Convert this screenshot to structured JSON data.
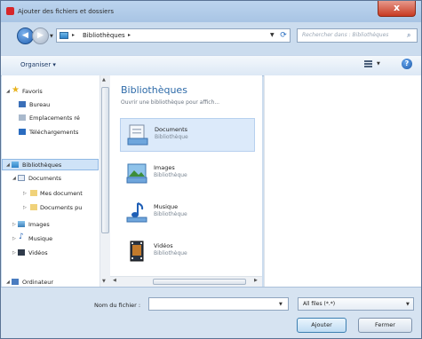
{
  "window": {
    "title": "Ajouter des fichiers et dossiers",
    "close_symbol": "x"
  },
  "address": {
    "back_symbol": "◀",
    "forward_symbol": "▶",
    "separator": "▸",
    "current_location": "Bibliothèques",
    "search_placeholder": "Rechercher dans : Bibliothèques"
  },
  "toolbar": {
    "organize_label": "Organiser ▾"
  },
  "nav": {
    "favorites": {
      "label": "Favoris",
      "items": [
        "Bureau",
        "Emplacements ré",
        "Téléchargements"
      ]
    },
    "libraries": {
      "label": "Bibliothèques"
    },
    "documents": {
      "label": "Documents",
      "children": [
        "Mes document",
        "Documents pu"
      ]
    },
    "images": "Images",
    "music": "Musique",
    "videos": "Vidéos",
    "computer": "Ordinateur"
  },
  "content": {
    "title": "Bibliothèques",
    "subtitle": "Ouvrir une bibliothèque pour affich...",
    "libraries": [
      {
        "name": "Documents",
        "type": "Bibliothèque",
        "icon": "documents-icon",
        "selected": true
      },
      {
        "name": "Images",
        "type": "Bibliothèque",
        "icon": "images-icon",
        "selected": false
      },
      {
        "name": "Musique",
        "type": "Bibliothèque",
        "icon": "music-icon",
        "selected": false
      },
      {
        "name": "Vidéos",
        "type": "Bibliothèque",
        "icon": "videos-icon",
        "selected": false
      }
    ]
  },
  "bottom": {
    "filename_label": "Nom du fichier :",
    "filename_value": "",
    "filter_value": "All files (*.*)",
    "open_button": "Ajouter",
    "cancel_button": "Fermer"
  },
  "colors": {
    "accent_blue": "#2d6aa8",
    "selection": "#dceafa",
    "close_red": "#c73a22",
    "frame": "#cbdcee"
  }
}
